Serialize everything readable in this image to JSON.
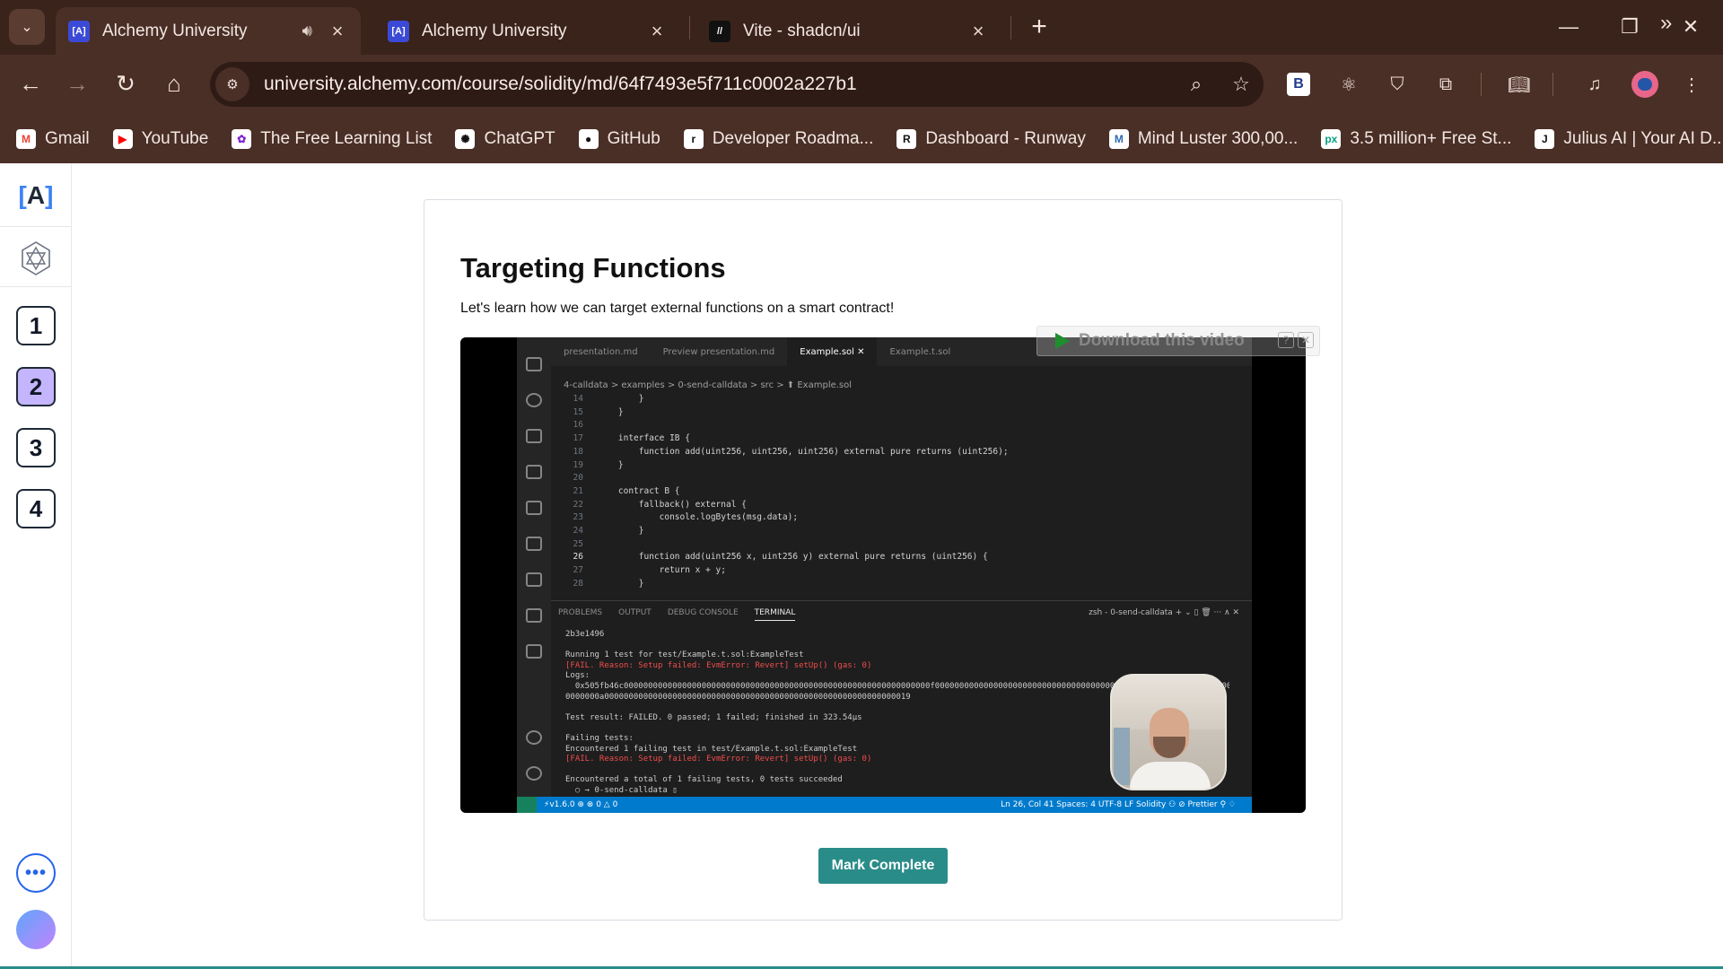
{
  "browser": {
    "tabs": [
      {
        "title": "Alchemy University",
        "favicon": "[A]",
        "active": true,
        "audio": true
      },
      {
        "title": "Alchemy University",
        "favicon": "[A]",
        "active": false
      },
      {
        "title": "Vite - shadcn/ui",
        "favicon": "//",
        "active": false
      }
    ],
    "url": "university.alchemy.com/course/solidity/md/64f7493e5f711c0002a227b1",
    "bookmarks": [
      {
        "label": "Gmail",
        "icon": "M",
        "color": "#ea4335"
      },
      {
        "label": "YouTube",
        "icon": "▶",
        "color": "#ff0000"
      },
      {
        "label": "The Free Learning List",
        "icon": "✿",
        "color": "#7e22ce"
      },
      {
        "label": "ChatGPT",
        "icon": "✺",
        "color": "#111111"
      },
      {
        "label": "GitHub",
        "icon": "●",
        "color": "#111111"
      },
      {
        "label": "Developer Roadma...",
        "icon": "r",
        "color": "#111111"
      },
      {
        "label": "Dashboard - Runway",
        "icon": "R",
        "color": "#111111"
      },
      {
        "label": "Mind Luster 300,00...",
        "icon": "M",
        "color": "#2b6cb0"
      },
      {
        "label": "3.5 million+ Free St...",
        "icon": "px",
        "color": "#05a081"
      },
      {
        "label": "Julius AI | Your AI D...",
        "icon": "J",
        "color": "#111111"
      }
    ],
    "extension_badge": "B"
  },
  "rail": {
    "logo": "A",
    "steps": [
      "1",
      "2",
      "3",
      "4"
    ],
    "active_step": "2",
    "more": "•••"
  },
  "lesson": {
    "title": "Targeting Functions",
    "subtitle": "Let's learn how we can target external functions on a smart contract!",
    "mark_complete": "Mark Complete"
  },
  "video": {
    "overlay_text": "Download this video",
    "overlay_help": "?",
    "overlay_close": "✕",
    "editor_tabs": [
      "presentation.md",
      "Preview presentation.md",
      "Example.sol ✕",
      "Example.t.sol"
    ],
    "breadcrumbs": "4-calldata > examples > 0-send-calldata > src > ⬆ Example.sol",
    "code_lines": [
      {
        "n": "14",
        "t": "        }"
      },
      {
        "n": "15",
        "t": "    }"
      },
      {
        "n": "16",
        "t": ""
      },
      {
        "n": "17",
        "t": "    interface IB {"
      },
      {
        "n": "18",
        "t": "        function add(uint256, uint256, uint256) external pure returns (uint256);"
      },
      {
        "n": "19",
        "t": "    }"
      },
      {
        "n": "20",
        "t": ""
      },
      {
        "n": "21",
        "t": "    contract B {"
      },
      {
        "n": "22",
        "t": "        fallback() external {"
      },
      {
        "n": "23",
        "t": "            console.logBytes(msg.data);"
      },
      {
        "n": "24",
        "t": "        }"
      },
      {
        "n": "25",
        "t": ""
      },
      {
        "n": "26",
        "t": "        function add(uint256 x, uint256 y) external pure returns (uint256) {"
      },
      {
        "n": "27",
        "t": "            return x + y;"
      },
      {
        "n": "28",
        "t": "        }"
      }
    ],
    "panel_tabs": [
      "PROBLEMS",
      "OUTPUT",
      "DEBUG CONSOLE",
      "TERMINAL"
    ],
    "panel_right": "zsh - 0-send-calldata  + ⌄  ▯  🗑  ···  ∧  ✕",
    "terminal_lines": [
      "2b3e1496",
      "",
      "Running 1 test for test/Example.t.sol:ExampleTest",
      "[FAIL. Reason: Setup failed: EvmError: Revert] setUp() (gas: 0)",
      "Logs:",
      "  0x505fb46c000000000000000000000000000000000000000000000000000000000000000f0000000000000000000000000000000000000000000000000000000000000",
      "0000000a000000000000000000000000000000000000000000000000000000000000019",
      "",
      "Test result: FAILED. 0 passed; 1 failed; finished in 323.54µs",
      "",
      "Failing tests:",
      "Encountered 1 failing test in test/Example.t.sol:ExampleTest",
      "[FAIL. Reason: Setup failed: EvmError: Revert] setUp() (gas: 0)",
      "",
      "Encountered a total of 1 failing tests, 0 tests succeeded",
      "  ○ → 0-send-calldata ▯"
    ],
    "status_left": "⚡v1.6.0 ⊕   ⊗ 0 △ 0",
    "status_right": "Ln 26, Col 41    Spaces: 4    UTF-8    LF    Solidity    ⚇    ⊘ Prettier    ⚲    ♢"
  },
  "colors": {
    "accent": "#2a8c88",
    "chrome_bg": "#4a2f26",
    "tabstrip_bg": "#3a231b",
    "active_step": "#c4b5fd"
  }
}
